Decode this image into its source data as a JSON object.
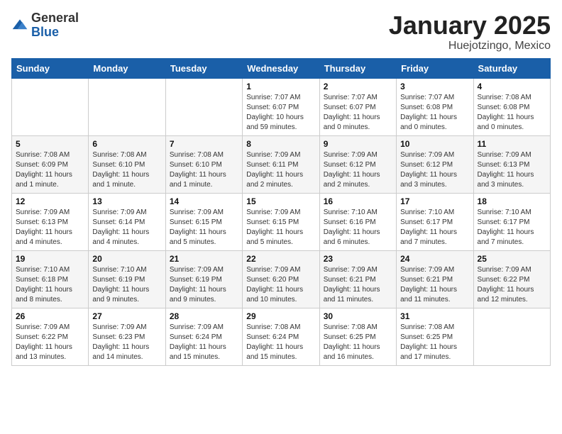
{
  "header": {
    "logo_general": "General",
    "logo_blue": "Blue",
    "month_title": "January 2025",
    "location": "Huejotzingo, Mexico"
  },
  "weekdays": [
    "Sunday",
    "Monday",
    "Tuesday",
    "Wednesday",
    "Thursday",
    "Friday",
    "Saturday"
  ],
  "weeks": [
    [
      {
        "day": "",
        "info": ""
      },
      {
        "day": "",
        "info": ""
      },
      {
        "day": "",
        "info": ""
      },
      {
        "day": "1",
        "info": "Sunrise: 7:07 AM\nSunset: 6:07 PM\nDaylight: 10 hours\nand 59 minutes."
      },
      {
        "day": "2",
        "info": "Sunrise: 7:07 AM\nSunset: 6:07 PM\nDaylight: 11 hours\nand 0 minutes."
      },
      {
        "day": "3",
        "info": "Sunrise: 7:07 AM\nSunset: 6:08 PM\nDaylight: 11 hours\nand 0 minutes."
      },
      {
        "day": "4",
        "info": "Sunrise: 7:08 AM\nSunset: 6:08 PM\nDaylight: 11 hours\nand 0 minutes."
      }
    ],
    [
      {
        "day": "5",
        "info": "Sunrise: 7:08 AM\nSunset: 6:09 PM\nDaylight: 11 hours\nand 1 minute."
      },
      {
        "day": "6",
        "info": "Sunrise: 7:08 AM\nSunset: 6:10 PM\nDaylight: 11 hours\nand 1 minute."
      },
      {
        "day": "7",
        "info": "Sunrise: 7:08 AM\nSunset: 6:10 PM\nDaylight: 11 hours\nand 1 minute."
      },
      {
        "day": "8",
        "info": "Sunrise: 7:09 AM\nSunset: 6:11 PM\nDaylight: 11 hours\nand 2 minutes."
      },
      {
        "day": "9",
        "info": "Sunrise: 7:09 AM\nSunset: 6:12 PM\nDaylight: 11 hours\nand 2 minutes."
      },
      {
        "day": "10",
        "info": "Sunrise: 7:09 AM\nSunset: 6:12 PM\nDaylight: 11 hours\nand 3 minutes."
      },
      {
        "day": "11",
        "info": "Sunrise: 7:09 AM\nSunset: 6:13 PM\nDaylight: 11 hours\nand 3 minutes."
      }
    ],
    [
      {
        "day": "12",
        "info": "Sunrise: 7:09 AM\nSunset: 6:13 PM\nDaylight: 11 hours\nand 4 minutes."
      },
      {
        "day": "13",
        "info": "Sunrise: 7:09 AM\nSunset: 6:14 PM\nDaylight: 11 hours\nand 4 minutes."
      },
      {
        "day": "14",
        "info": "Sunrise: 7:09 AM\nSunset: 6:15 PM\nDaylight: 11 hours\nand 5 minutes."
      },
      {
        "day": "15",
        "info": "Sunrise: 7:09 AM\nSunset: 6:15 PM\nDaylight: 11 hours\nand 5 minutes."
      },
      {
        "day": "16",
        "info": "Sunrise: 7:10 AM\nSunset: 6:16 PM\nDaylight: 11 hours\nand 6 minutes."
      },
      {
        "day": "17",
        "info": "Sunrise: 7:10 AM\nSunset: 6:17 PM\nDaylight: 11 hours\nand 7 minutes."
      },
      {
        "day": "18",
        "info": "Sunrise: 7:10 AM\nSunset: 6:17 PM\nDaylight: 11 hours\nand 7 minutes."
      }
    ],
    [
      {
        "day": "19",
        "info": "Sunrise: 7:10 AM\nSunset: 6:18 PM\nDaylight: 11 hours\nand 8 minutes."
      },
      {
        "day": "20",
        "info": "Sunrise: 7:10 AM\nSunset: 6:19 PM\nDaylight: 11 hours\nand 9 minutes."
      },
      {
        "day": "21",
        "info": "Sunrise: 7:09 AM\nSunset: 6:19 PM\nDaylight: 11 hours\nand 9 minutes."
      },
      {
        "day": "22",
        "info": "Sunrise: 7:09 AM\nSunset: 6:20 PM\nDaylight: 11 hours\nand 10 minutes."
      },
      {
        "day": "23",
        "info": "Sunrise: 7:09 AM\nSunset: 6:21 PM\nDaylight: 11 hours\nand 11 minutes."
      },
      {
        "day": "24",
        "info": "Sunrise: 7:09 AM\nSunset: 6:21 PM\nDaylight: 11 hours\nand 11 minutes."
      },
      {
        "day": "25",
        "info": "Sunrise: 7:09 AM\nSunset: 6:22 PM\nDaylight: 11 hours\nand 12 minutes."
      }
    ],
    [
      {
        "day": "26",
        "info": "Sunrise: 7:09 AM\nSunset: 6:22 PM\nDaylight: 11 hours\nand 13 minutes."
      },
      {
        "day": "27",
        "info": "Sunrise: 7:09 AM\nSunset: 6:23 PM\nDaylight: 11 hours\nand 14 minutes."
      },
      {
        "day": "28",
        "info": "Sunrise: 7:09 AM\nSunset: 6:24 PM\nDaylight: 11 hours\nand 15 minutes."
      },
      {
        "day": "29",
        "info": "Sunrise: 7:08 AM\nSunset: 6:24 PM\nDaylight: 11 hours\nand 15 minutes."
      },
      {
        "day": "30",
        "info": "Sunrise: 7:08 AM\nSunset: 6:25 PM\nDaylight: 11 hours\nand 16 minutes."
      },
      {
        "day": "31",
        "info": "Sunrise: 7:08 AM\nSunset: 6:25 PM\nDaylight: 11 hours\nand 17 minutes."
      },
      {
        "day": "",
        "info": ""
      }
    ]
  ]
}
